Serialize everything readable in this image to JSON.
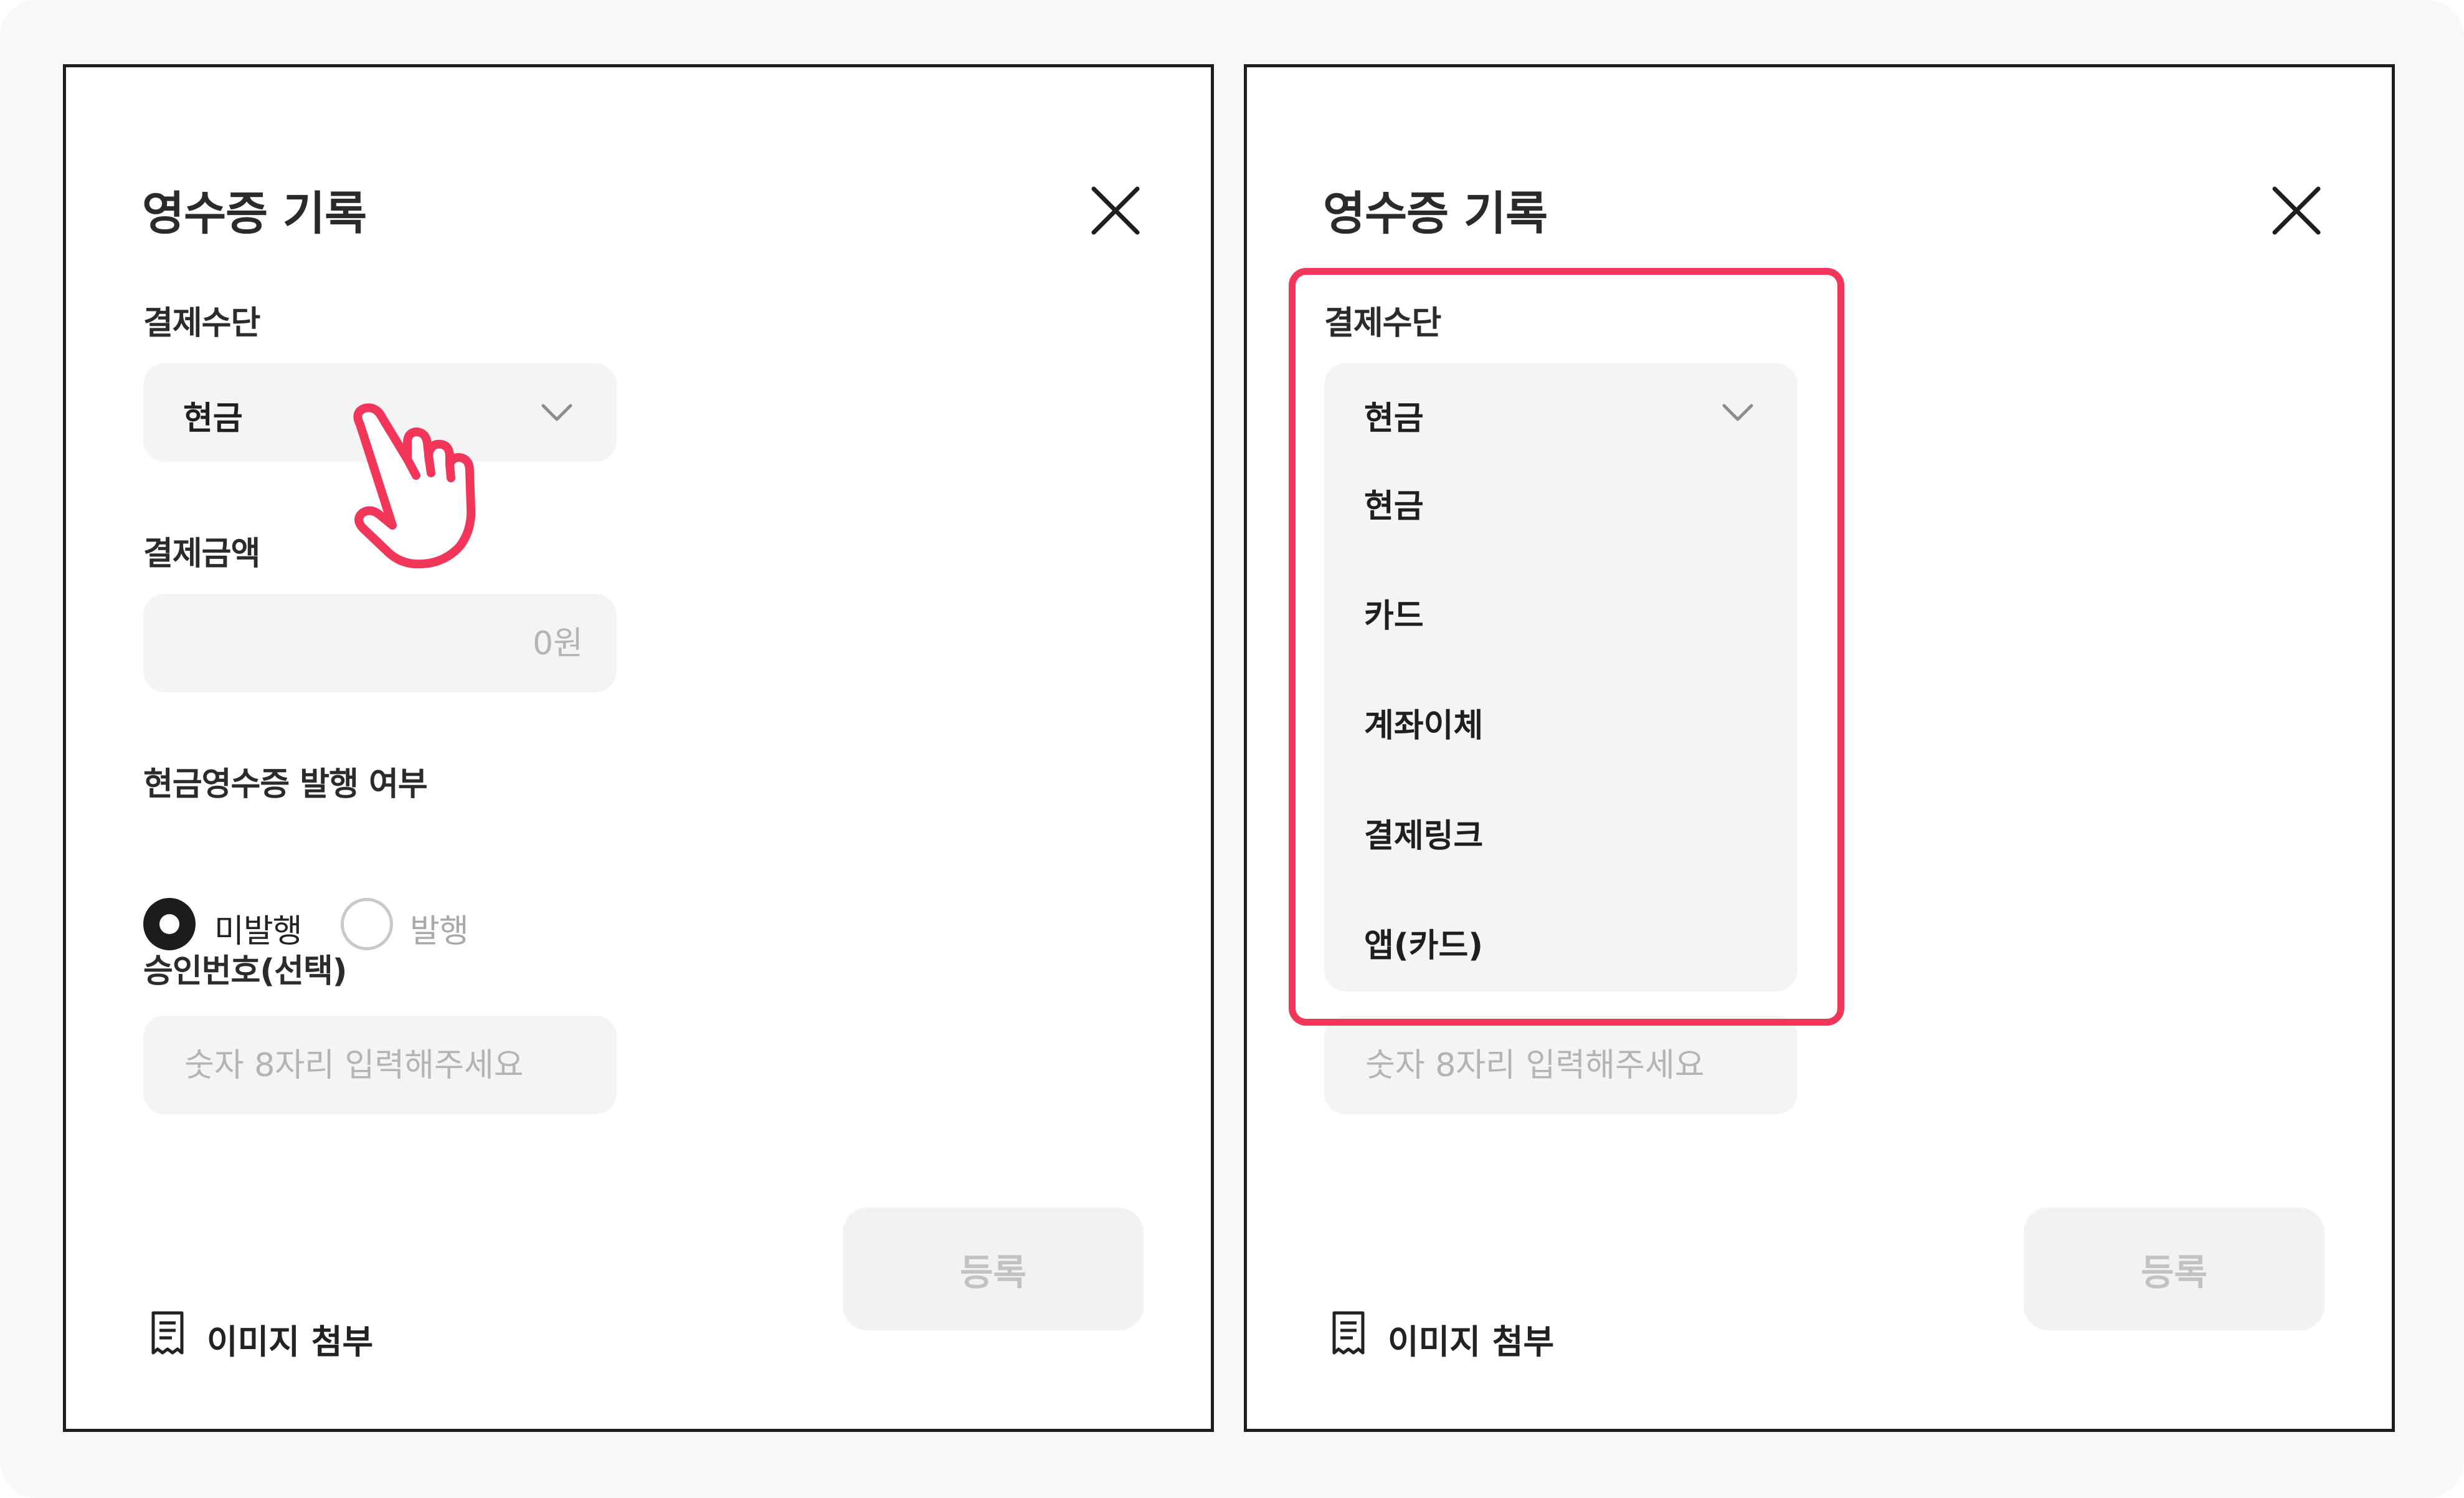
{
  "title": "영수증 기록",
  "payment_method": {
    "label": "결제수단",
    "selected": "현금",
    "options": [
      "현금",
      "카드",
      "계좌이체",
      "결제링크",
      "앱(카드)"
    ]
  },
  "amount": {
    "label": "결제금액",
    "placeholder": "0원"
  },
  "cash_receipt": {
    "label": "현금영수증 발행 여부",
    "options": [
      "미발행",
      "발행"
    ],
    "selected": "미발행"
  },
  "approval": {
    "label": "승인번호(선택)",
    "placeholder": "숫자 8자리 입력해주세요"
  },
  "attach_label": "이미지 첨부",
  "submit_label": "등록",
  "colors": {
    "highlight": "#f2365a",
    "field_bg": "#f4f4f4",
    "disabled_text": "#c2c2c2"
  },
  "icons": {
    "close": "close-icon",
    "chevron": "chevron-down-icon",
    "attach": "receipt-icon",
    "pointer": "hand-pointer-icon"
  }
}
